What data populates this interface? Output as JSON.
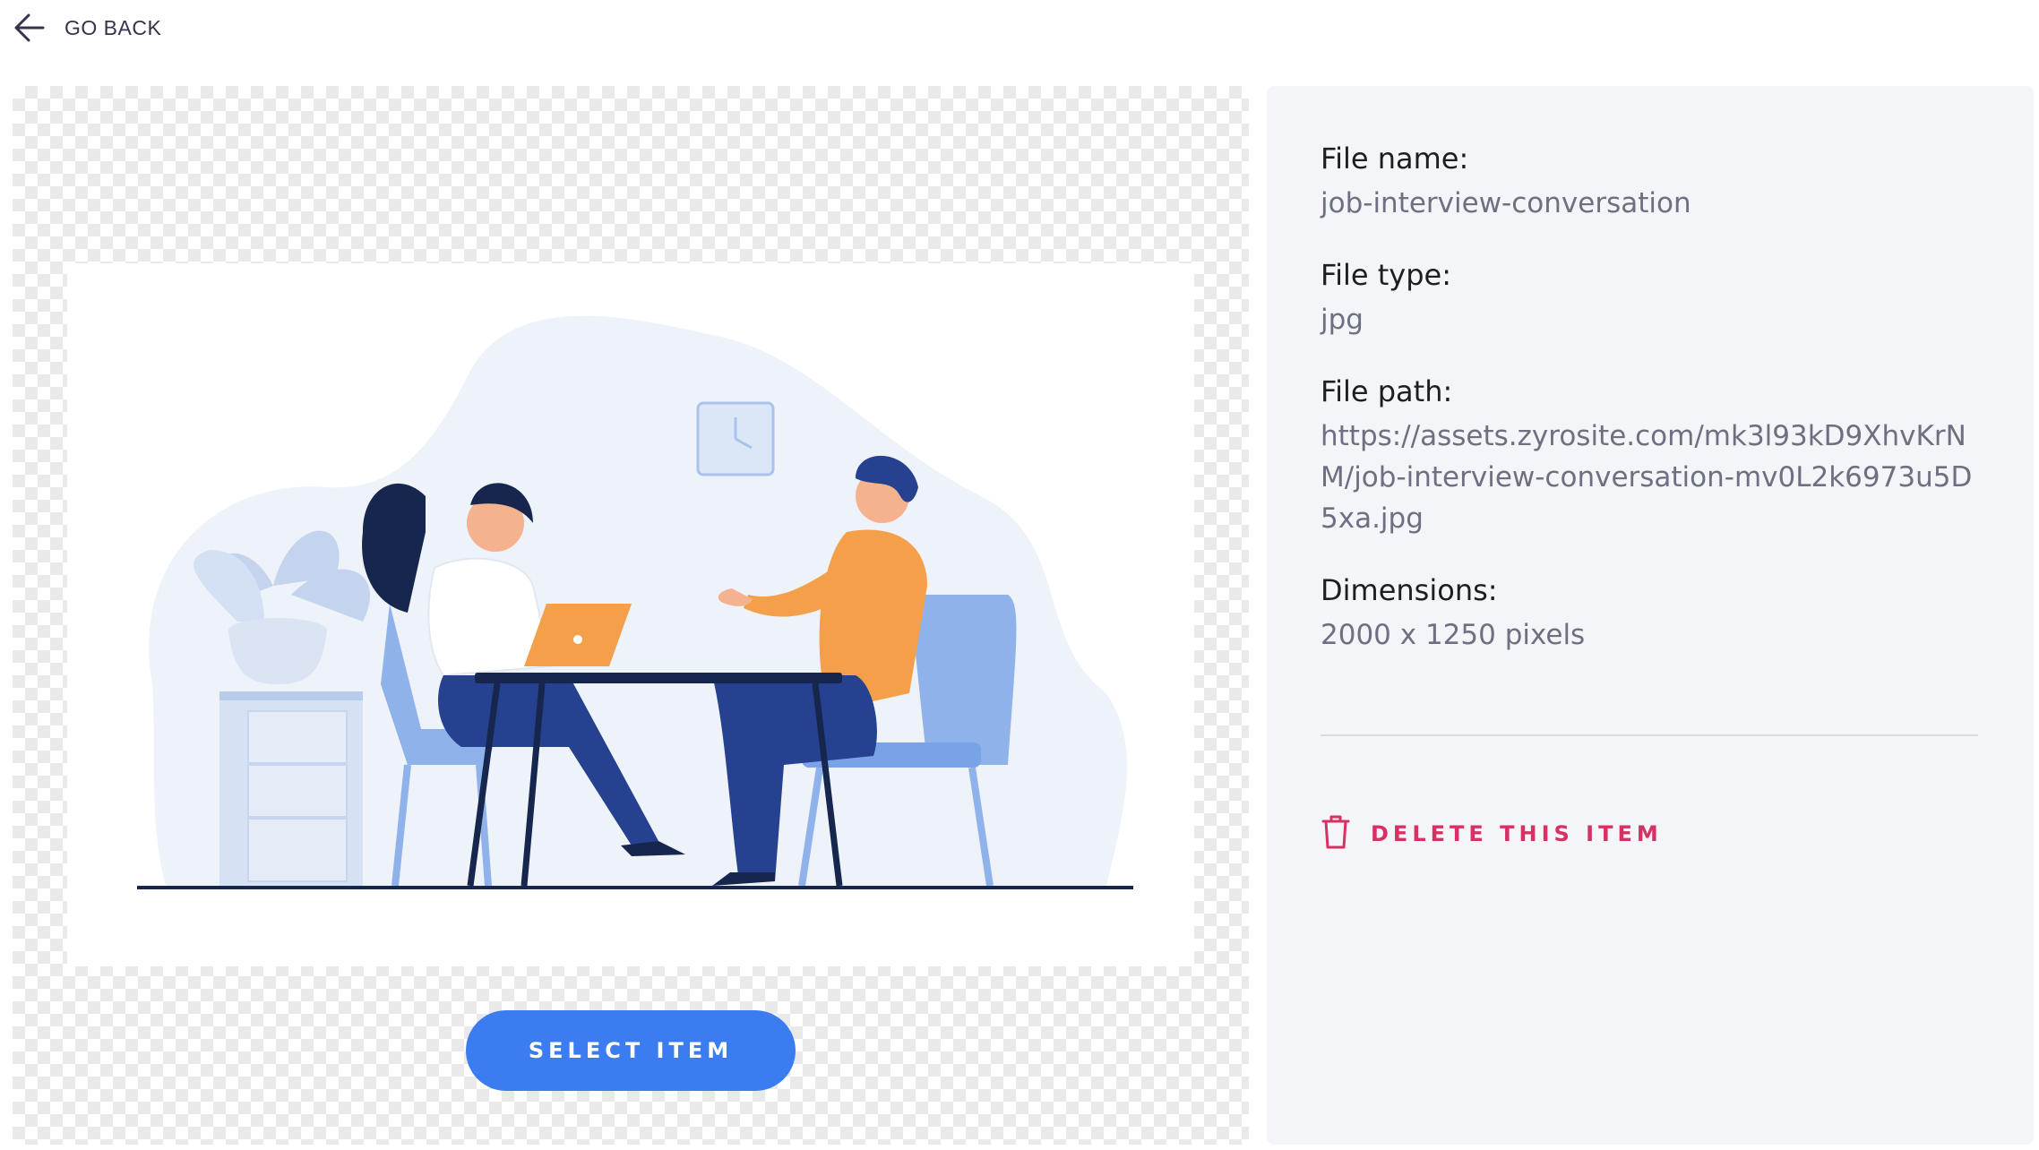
{
  "nav": {
    "back_label": "GO BACK",
    "back_icon": "arrow-left-icon"
  },
  "preview": {
    "illustration": "job-interview-illustration",
    "select_label": "SELECT ITEM",
    "button_color": "#3b7cf0"
  },
  "details": {
    "file_name_label": "File name:",
    "file_name": "job-interview-conversation",
    "file_type_label": "File type:",
    "file_type": "jpg",
    "file_path_label": "File path:",
    "file_path": "https://assets.zyrosite.com/mk3l93kD9XhvKrNM/job-interview-conversation-mv0L2k6973u5D5xa.jpg",
    "dimensions_label": "Dimensions:",
    "dimensions": "2000 x 1250 pixels"
  },
  "actions": {
    "delete_label": "DELETE THIS ITEM",
    "delete_icon": "trash-icon",
    "delete_color": "#d63163"
  }
}
